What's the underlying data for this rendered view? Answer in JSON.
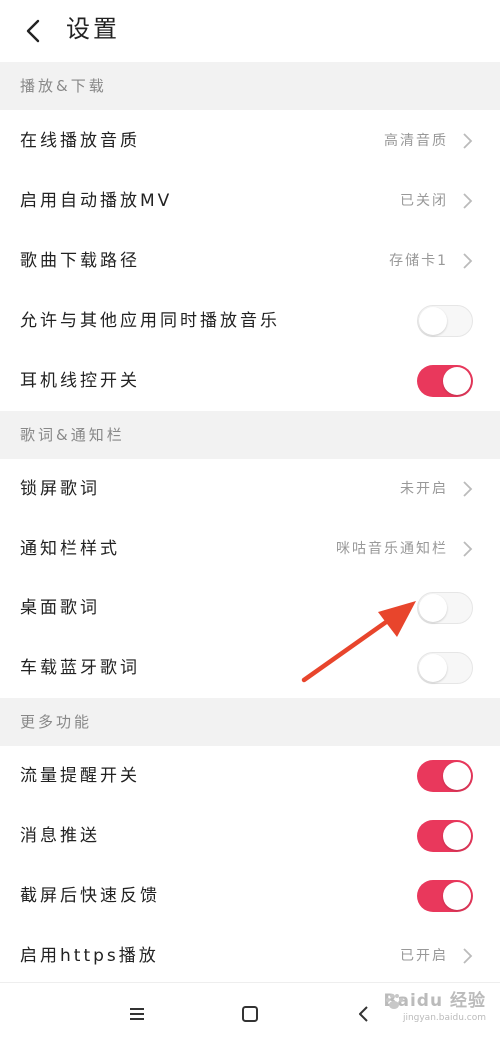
{
  "header": {
    "title": "设置"
  },
  "sections": [
    {
      "title": "播放&下载",
      "rows": [
        {
          "label": "在线播放音质",
          "type": "link",
          "value": "高清音质"
        },
        {
          "label": "启用自动播放MV",
          "type": "link",
          "value": "已关闭"
        },
        {
          "label": "歌曲下载路径",
          "type": "link",
          "value": "存储卡1"
        },
        {
          "label": "允许与其他应用同时播放音乐",
          "type": "toggle",
          "on": false
        },
        {
          "label": "耳机线控开关",
          "type": "toggle",
          "on": true
        }
      ]
    },
    {
      "title": "歌词&通知栏",
      "rows": [
        {
          "label": "锁屏歌词",
          "type": "link",
          "value": "未开启"
        },
        {
          "label": "通知栏样式",
          "type": "link",
          "value": "咪咕音乐通知栏"
        },
        {
          "label": "桌面歌词",
          "type": "toggle",
          "on": false
        },
        {
          "label": "车载蓝牙歌词",
          "type": "toggle",
          "on": false
        }
      ]
    },
    {
      "title": "更多功能",
      "rows": [
        {
          "label": "流量提醒开关",
          "type": "toggle",
          "on": true
        },
        {
          "label": "消息推送",
          "type": "toggle",
          "on": true
        },
        {
          "label": "截屏后快速反馈",
          "type": "toggle",
          "on": true
        },
        {
          "label": "启用https播放",
          "type": "link",
          "value": "已开启"
        }
      ]
    }
  ],
  "navbar": {
    "icons": [
      "menu-icon",
      "home-square-icon",
      "back-triangle-icon"
    ]
  },
  "watermark": {
    "main": "Baidu 经验",
    "sub": "jingyan.baidu.com"
  },
  "colors": {
    "accent": "#e9385c",
    "section_bg": "#f2f2f2",
    "annotation_arrow": "#e8452c"
  }
}
